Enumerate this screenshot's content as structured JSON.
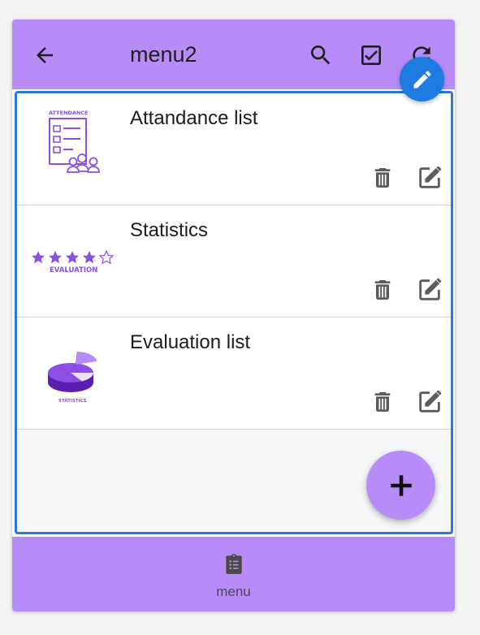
{
  "appbar": {
    "title": "menu2",
    "back_icon": "arrow-left-icon",
    "actions": [
      "search-icon",
      "checkbox-icon",
      "refresh-icon"
    ]
  },
  "edit_fab_icon": "pencil-icon",
  "items": [
    {
      "title": "Attandance list",
      "image_text": "ATTENDANCE",
      "image": "attendance-clipboard-image"
    },
    {
      "title": "Statistics",
      "image_text": "EVALUATION",
      "image": "evaluation-stars-image"
    },
    {
      "title": "Evaluation list",
      "image_text": "STATISTICS",
      "image": "statistics-pie-image"
    }
  ],
  "item_actions": [
    "delete-icon",
    "edit-icon"
  ],
  "add_fab_icon": "plus-icon",
  "bottom_nav": {
    "label": "menu",
    "icon": "clipboard-list-icon"
  },
  "colors": {
    "accent": "#b88cf8",
    "primary_blue": "#1e7be0",
    "border_blue": "#2a7ad6",
    "logo_purple": "#8b4fe6"
  }
}
